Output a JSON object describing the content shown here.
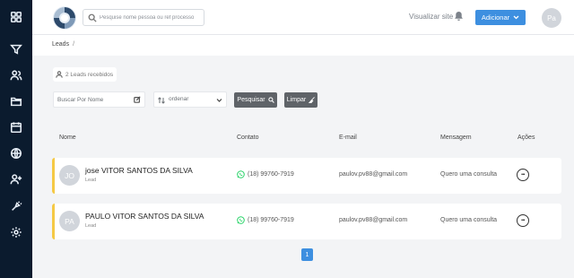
{
  "sidebar": {
    "items": [
      {
        "icon": "grid-icon"
      },
      {
        "icon": "filter-icon"
      },
      {
        "icon": "users-icon"
      },
      {
        "icon": "folder-icon"
      },
      {
        "icon": "calendar-icon"
      },
      {
        "icon": "globe-icon"
      },
      {
        "icon": "user-plus-icon"
      },
      {
        "icon": "puzzle-icon"
      },
      {
        "icon": "settings-icon"
      }
    ]
  },
  "header": {
    "search_placeholder": "Pesquise nome pessoa ou ref processo",
    "view_site_label": "Visualizar site",
    "add_label": "Adicionar",
    "avatar_initials": "Pa"
  },
  "breadcrumb": {
    "current": "Leads",
    "separator": "/"
  },
  "leads_count": "2 Leads recebidos",
  "filters": {
    "name_placeholder": "Buscar Por Nome",
    "order_label": "ordenar",
    "search_button": "Pesquisar",
    "clear_button": "Limpar"
  },
  "table": {
    "columns": [
      "Nome",
      "Contato",
      "E-mail",
      "Mensagem",
      "Ações"
    ]
  },
  "leads": [
    {
      "initials": "JO",
      "name": "jose VITOR SANTOS DA SILVA",
      "type": "Lead",
      "phone": "(18) 99760-7919",
      "email": "paulov.pv88@gmail.com",
      "message": "Quero uma consulta",
      "actions": "•••"
    },
    {
      "initials": "PA",
      "name": "PAULO VITOR SANTOS DA SILVA",
      "type": "Lead",
      "phone": "(18) 99760-7919",
      "email": "paulov.pv88@gmail.com",
      "message": "Quero uma consulta",
      "actions": "•••"
    }
  ],
  "pagination": {
    "current_page": "1"
  },
  "colors": {
    "sidebar_bg": "#0b1b2e",
    "accent": "#3d8fe0",
    "lead_border": "#f5c945",
    "whatsapp": "#25d366"
  }
}
